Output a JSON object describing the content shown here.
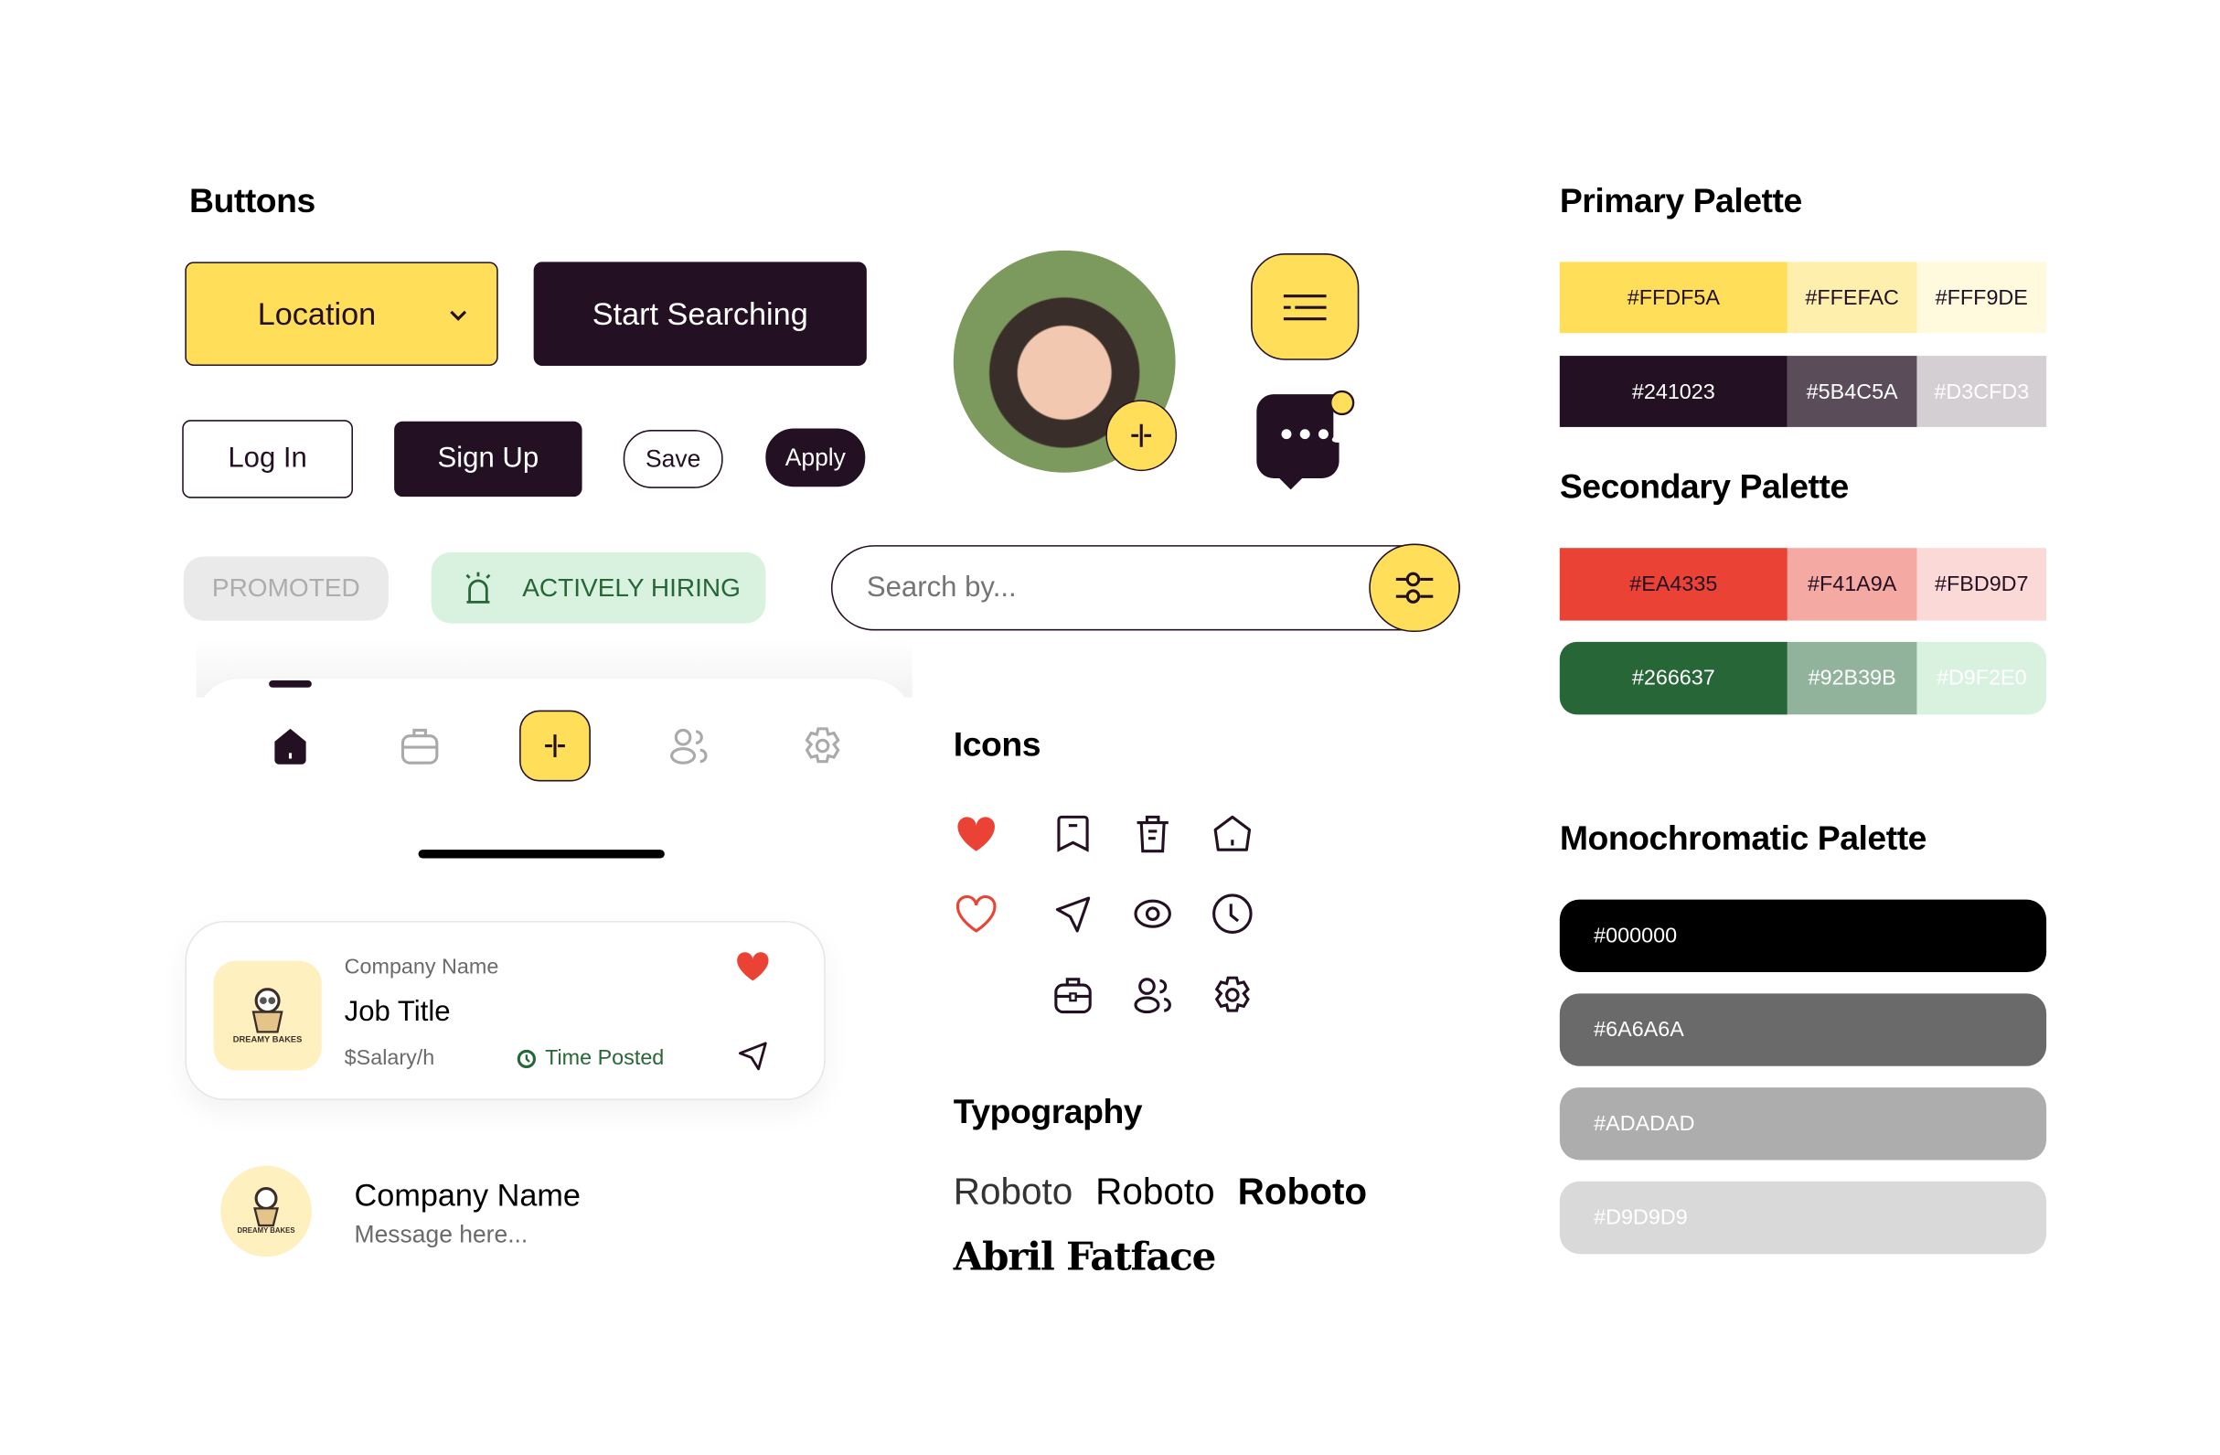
{
  "sections": {
    "buttons": "Buttons",
    "icons": "Icons",
    "typography": "Typography",
    "primary": "Primary Palette",
    "secondary": "Secondary Palette",
    "mono": "Monochromatic Palette"
  },
  "buttons": {
    "location": "Location",
    "start_searching": "Start Searching",
    "log_in": "Log In",
    "sign_up": "Sign Up",
    "save": "Save",
    "apply": "Apply"
  },
  "tags": {
    "promoted": "PROMOTED",
    "actively_hiring": "ACTIVELY HIRING"
  },
  "search": {
    "placeholder": "Search by..."
  },
  "job_card": {
    "company": "Company Name",
    "title": "Job Title",
    "salary": "$Salary/h",
    "time": "Time Posted",
    "logo_text": "DREAMY BAKES"
  },
  "message": {
    "company": "Company Name",
    "text": "Message here...",
    "logo_text": "DREAMY BAKES"
  },
  "typography": {
    "light": "Roboto",
    "regular": "Roboto",
    "bold": "Roboto",
    "display": "Abril Fatface"
  },
  "palette": {
    "primary": [
      [
        "#FFDF5A",
        "#FFEFAC",
        "#FFF9DE"
      ],
      [
        "#241023",
        "#5B4C5A",
        "#D3CFD3"
      ]
    ],
    "secondary": [
      [
        "#EA4335",
        "#F41A9A",
        "#FBD9D7"
      ],
      [
        "#266637",
        "#92B39B",
        "#D9F2E0"
      ]
    ],
    "primary_labels": [
      "#FFDF5A",
      "#FFEFAC",
      "#FFF9DE",
      "#241023",
      "#5B4C5A",
      "#D3CFD3"
    ],
    "secondary_labels": [
      "#EA4335",
      "#F41A9A",
      "#FBD9D7",
      "#266637",
      "#92B39B",
      "#D9F2E0"
    ],
    "mono": [
      "#000000",
      "#6A6A6A",
      "#ADADAD",
      "#D9D9D9"
    ]
  },
  "colors": {
    "accent": "#FFDF5A",
    "dark": "#241023",
    "red": "#EA4335",
    "green": "#266637"
  },
  "nav_icons": [
    "home-icon",
    "briefcase-icon",
    "plus-icon",
    "users-icon",
    "gear-icon"
  ]
}
